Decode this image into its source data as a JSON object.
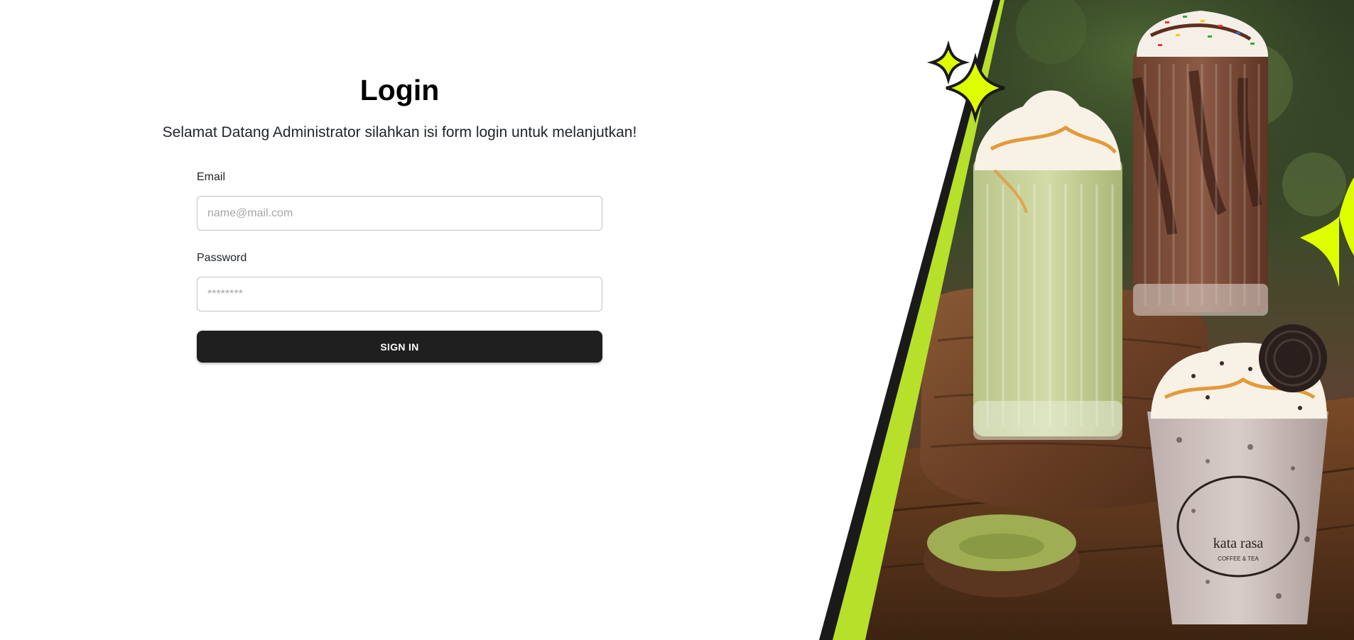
{
  "login": {
    "title": "Login",
    "subtitle": "Selamat Datang Administrator silahkan isi form login untuk melanjutkan!",
    "email_label": "Email",
    "email_placeholder": "name@mail.com",
    "email_value": "",
    "password_label": "Password",
    "password_placeholder": "********",
    "password_value": "",
    "signin_label": "SIGN IN"
  },
  "hero": {
    "logo_text": "kata rasa",
    "logo_small": "COFFEE & TEA",
    "colors": {
      "accent_lime": "#b7e02b",
      "sparkle": "#ddff00",
      "stripe_dark": "#1a1a1a"
    }
  }
}
